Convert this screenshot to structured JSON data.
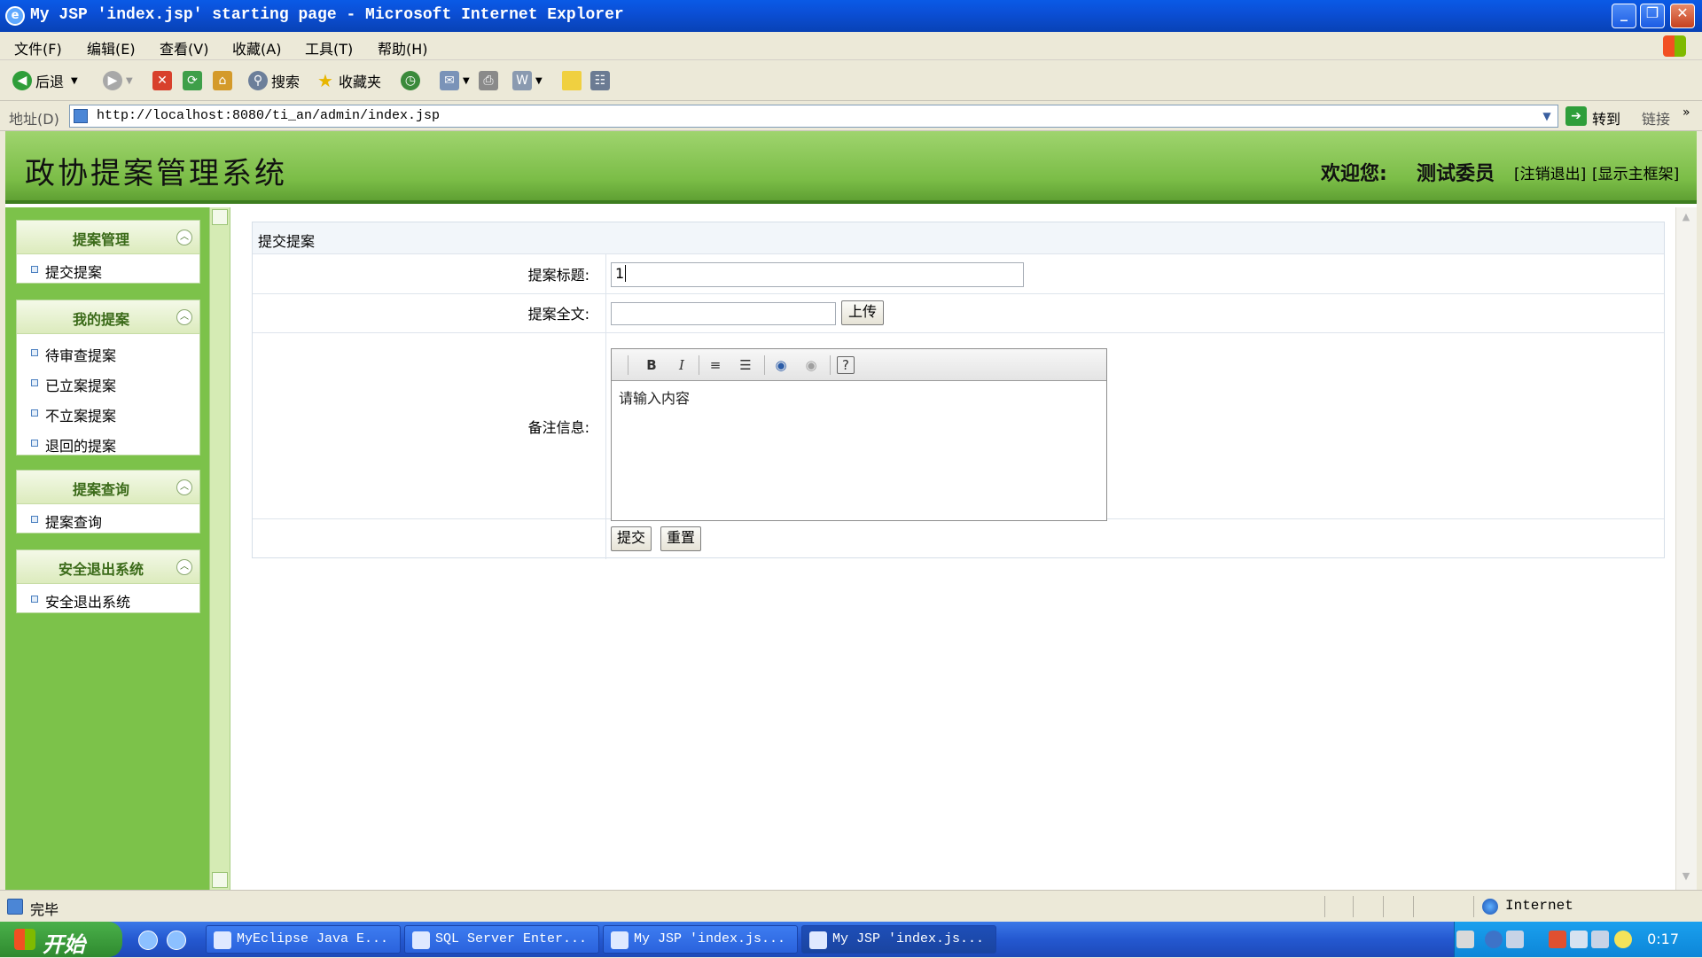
{
  "window": {
    "title": "My JSP 'index.jsp' starting page - Microsoft Internet Explorer",
    "logo": "ie-logo-icon",
    "controls": {
      "minimize": "_",
      "maximize": "❐",
      "close": "✕"
    }
  },
  "menubar": {
    "items": [
      "文件(F)",
      "编辑(E)",
      "查看(V)",
      "收藏(A)",
      "工具(T)",
      "帮助(H)"
    ]
  },
  "toolbar": {
    "back": "后退",
    "search": "搜索",
    "favorites": "收藏夹"
  },
  "address": {
    "label": "地址(D)",
    "url": "http://localhost:8080/ti_an/admin/index.jsp",
    "go": "转到",
    "links": "链接"
  },
  "header": {
    "title": "政协提案管理系统",
    "welcome": "欢迎您:",
    "user": "测试委员",
    "logout": "[注销退出]",
    "main_frame": "[显示主框架]"
  },
  "sidebar": {
    "groups": [
      {
        "title": "提案管理",
        "items": [
          "提交提案"
        ]
      },
      {
        "title": "我的提案",
        "items": [
          "待审查提案",
          "已立案提案",
          "不立案提案",
          "退回的提案"
        ]
      },
      {
        "title": "提案查询",
        "items": [
          "提案查询"
        ]
      },
      {
        "title": "安全退出系统",
        "items": [
          "安全退出系统"
        ]
      }
    ]
  },
  "form": {
    "panel_title": "提交提案",
    "title_label": "提案标题:",
    "title_value": "1",
    "fulltext_label": "提案全文:",
    "upload_button": "上传",
    "remark_label": "备注信息:",
    "editor_placeholder": "请输入内容",
    "submit": "提交",
    "reset": "重置"
  },
  "status": {
    "text": "完毕",
    "zone": "Internet"
  },
  "taskbar": {
    "start": "开始",
    "tasks": [
      "MyEclipse Java E...",
      "SQL Server Enter...",
      "My JSP 'index.js...",
      "My JSP 'index.js..."
    ],
    "clock": "0:17"
  },
  "colors": {
    "header_green": "#7bbd47",
    "sidebar_green": "#7cc24a",
    "xp_blue": "#0b4fd6"
  }
}
